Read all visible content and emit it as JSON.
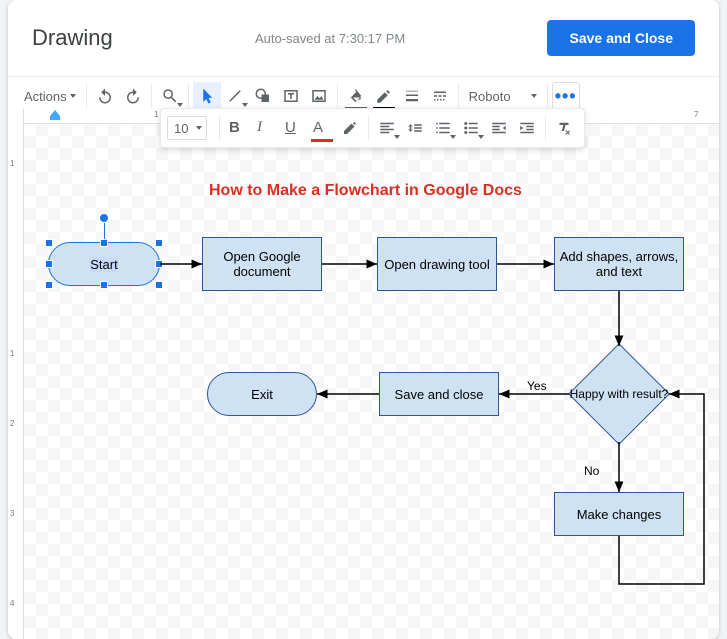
{
  "dialog": {
    "title": "Drawing",
    "autosave": "Auto-saved at 7:30:17 PM",
    "save_button": "Save and Close"
  },
  "toolbar": {
    "actions": "Actions",
    "font_family": "Roboto",
    "font_size": "10"
  },
  "flowchart": {
    "title": "How to Make a Flowchart in Google Docs",
    "start": "Start",
    "open_doc": "Open Google document",
    "open_draw": "Open drawing tool",
    "add_shapes": "Add shapes, arrows, and text",
    "happy": "Happy with result?",
    "yes": "Yes",
    "no": "No",
    "save_close": "Save and close",
    "make_changes": "Make changes",
    "exit": "Exit"
  }
}
